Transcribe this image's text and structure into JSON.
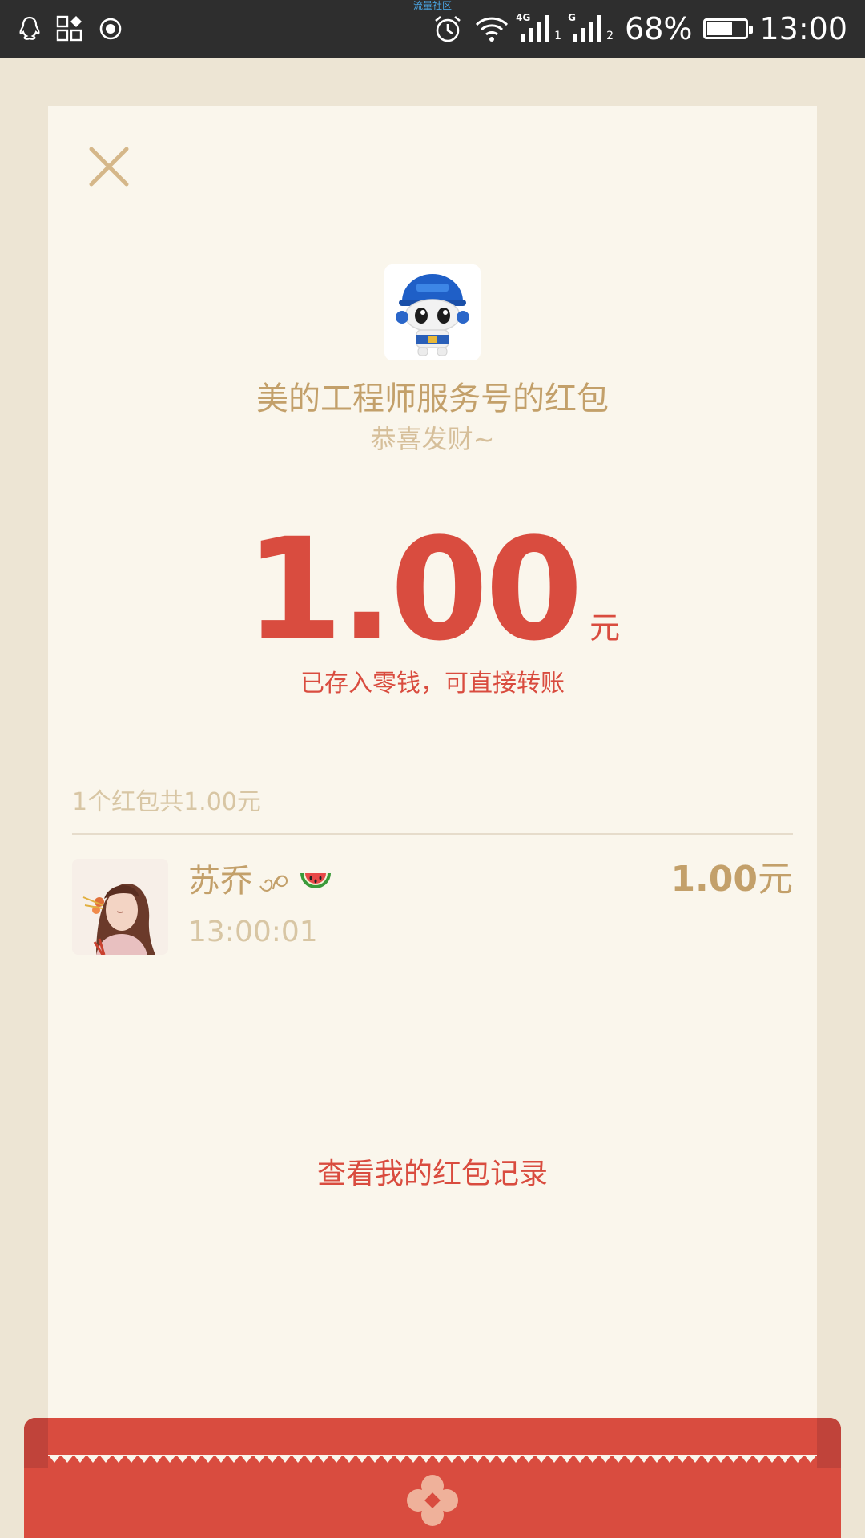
{
  "status_bar": {
    "carrier_label": "流量社区",
    "network_1": "4G",
    "sim_1": "1",
    "network_2": "G",
    "sim_2": "2",
    "battery_percent": "68%",
    "battery_level": 0.68,
    "time": "13:00",
    "icons": [
      "qq-icon",
      "app-grid-icon",
      "record-icon",
      "alarm-icon",
      "wifi-icon",
      "signal-icon",
      "battery-icon"
    ]
  },
  "red_packet": {
    "sender_title": "美的工程师服务号的红包",
    "greeting": "恭喜发财~",
    "amount": "1.00",
    "amount_unit": "元",
    "notice": "已存入零钱，可直接转账",
    "summary": "1个红包共1.00元"
  },
  "records": [
    {
      "name": "苏乔",
      "time": "13:00:01",
      "amount": "1.00",
      "unit": "元"
    }
  ],
  "links": {
    "history": "查看我的红包记录"
  },
  "colors": {
    "accent_red": "#d94c3f",
    "gold_text": "#c3a06a",
    "light_gold": "#d8c6a4",
    "card_bg": "#faf6ec",
    "page_bg": "#ede5d4",
    "status_bar": "#2e2e2e"
  }
}
